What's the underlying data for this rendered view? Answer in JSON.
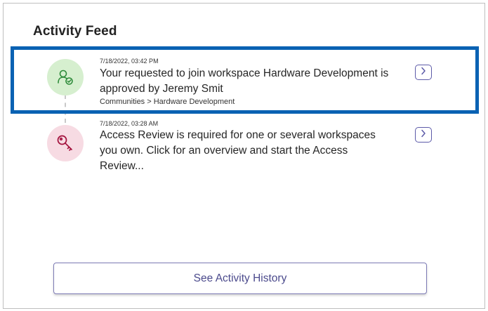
{
  "feed": {
    "title": "Activity Feed",
    "items": [
      {
        "timestamp": "7/18/2022, 03:42 PM",
        "text": "Your requested to join workspace Hardware Development is approved by Jeremy Smit",
        "breadcrumb": "Communities > Hardware Development",
        "icon": "user-check-icon",
        "icon_color": "#2e8b3a",
        "icon_bg": "#d6efcf"
      },
      {
        "timestamp": "7/18/2022, 03:28 AM",
        "text": "Access Review is required for one or several workspaces you own. Click for an overview and start the Access Review...",
        "icon": "key-icon",
        "icon_color": "#a3123d",
        "icon_bg": "#f7dbe3"
      }
    ],
    "history_button_label": "See Activity History"
  },
  "colors": {
    "highlight_border": "#0a62b3",
    "accent": "#5c5aa8"
  }
}
